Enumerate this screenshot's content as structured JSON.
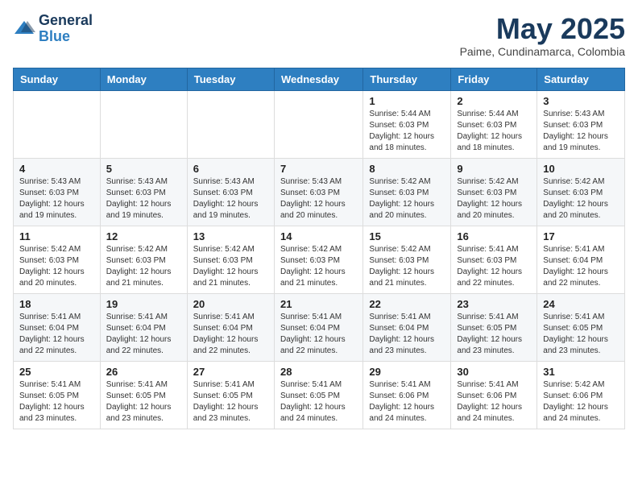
{
  "header": {
    "logo_general": "General",
    "logo_blue": "Blue",
    "title": "May 2025",
    "location": "Paime, Cundinamarca, Colombia"
  },
  "weekdays": [
    "Sunday",
    "Monday",
    "Tuesday",
    "Wednesday",
    "Thursday",
    "Friday",
    "Saturday"
  ],
  "weeks": [
    [
      {
        "day": "",
        "info": ""
      },
      {
        "day": "",
        "info": ""
      },
      {
        "day": "",
        "info": ""
      },
      {
        "day": "",
        "info": ""
      },
      {
        "day": "1",
        "info": "Sunrise: 5:44 AM\nSunset: 6:03 PM\nDaylight: 12 hours\nand 18 minutes."
      },
      {
        "day": "2",
        "info": "Sunrise: 5:44 AM\nSunset: 6:03 PM\nDaylight: 12 hours\nand 18 minutes."
      },
      {
        "day": "3",
        "info": "Sunrise: 5:43 AM\nSunset: 6:03 PM\nDaylight: 12 hours\nand 19 minutes."
      }
    ],
    [
      {
        "day": "4",
        "info": "Sunrise: 5:43 AM\nSunset: 6:03 PM\nDaylight: 12 hours\nand 19 minutes."
      },
      {
        "day": "5",
        "info": "Sunrise: 5:43 AM\nSunset: 6:03 PM\nDaylight: 12 hours\nand 19 minutes."
      },
      {
        "day": "6",
        "info": "Sunrise: 5:43 AM\nSunset: 6:03 PM\nDaylight: 12 hours\nand 19 minutes."
      },
      {
        "day": "7",
        "info": "Sunrise: 5:43 AM\nSunset: 6:03 PM\nDaylight: 12 hours\nand 20 minutes."
      },
      {
        "day": "8",
        "info": "Sunrise: 5:42 AM\nSunset: 6:03 PM\nDaylight: 12 hours\nand 20 minutes."
      },
      {
        "day": "9",
        "info": "Sunrise: 5:42 AM\nSunset: 6:03 PM\nDaylight: 12 hours\nand 20 minutes."
      },
      {
        "day": "10",
        "info": "Sunrise: 5:42 AM\nSunset: 6:03 PM\nDaylight: 12 hours\nand 20 minutes."
      }
    ],
    [
      {
        "day": "11",
        "info": "Sunrise: 5:42 AM\nSunset: 6:03 PM\nDaylight: 12 hours\nand 20 minutes."
      },
      {
        "day": "12",
        "info": "Sunrise: 5:42 AM\nSunset: 6:03 PM\nDaylight: 12 hours\nand 21 minutes."
      },
      {
        "day": "13",
        "info": "Sunrise: 5:42 AM\nSunset: 6:03 PM\nDaylight: 12 hours\nand 21 minutes."
      },
      {
        "day": "14",
        "info": "Sunrise: 5:42 AM\nSunset: 6:03 PM\nDaylight: 12 hours\nand 21 minutes."
      },
      {
        "day": "15",
        "info": "Sunrise: 5:42 AM\nSunset: 6:03 PM\nDaylight: 12 hours\nand 21 minutes."
      },
      {
        "day": "16",
        "info": "Sunrise: 5:41 AM\nSunset: 6:03 PM\nDaylight: 12 hours\nand 22 minutes."
      },
      {
        "day": "17",
        "info": "Sunrise: 5:41 AM\nSunset: 6:04 PM\nDaylight: 12 hours\nand 22 minutes."
      }
    ],
    [
      {
        "day": "18",
        "info": "Sunrise: 5:41 AM\nSunset: 6:04 PM\nDaylight: 12 hours\nand 22 minutes."
      },
      {
        "day": "19",
        "info": "Sunrise: 5:41 AM\nSunset: 6:04 PM\nDaylight: 12 hours\nand 22 minutes."
      },
      {
        "day": "20",
        "info": "Sunrise: 5:41 AM\nSunset: 6:04 PM\nDaylight: 12 hours\nand 22 minutes."
      },
      {
        "day": "21",
        "info": "Sunrise: 5:41 AM\nSunset: 6:04 PM\nDaylight: 12 hours\nand 22 minutes."
      },
      {
        "day": "22",
        "info": "Sunrise: 5:41 AM\nSunset: 6:04 PM\nDaylight: 12 hours\nand 23 minutes."
      },
      {
        "day": "23",
        "info": "Sunrise: 5:41 AM\nSunset: 6:05 PM\nDaylight: 12 hours\nand 23 minutes."
      },
      {
        "day": "24",
        "info": "Sunrise: 5:41 AM\nSunset: 6:05 PM\nDaylight: 12 hours\nand 23 minutes."
      }
    ],
    [
      {
        "day": "25",
        "info": "Sunrise: 5:41 AM\nSunset: 6:05 PM\nDaylight: 12 hours\nand 23 minutes."
      },
      {
        "day": "26",
        "info": "Sunrise: 5:41 AM\nSunset: 6:05 PM\nDaylight: 12 hours\nand 23 minutes."
      },
      {
        "day": "27",
        "info": "Sunrise: 5:41 AM\nSunset: 6:05 PM\nDaylight: 12 hours\nand 23 minutes."
      },
      {
        "day": "28",
        "info": "Sunrise: 5:41 AM\nSunset: 6:05 PM\nDaylight: 12 hours\nand 24 minutes."
      },
      {
        "day": "29",
        "info": "Sunrise: 5:41 AM\nSunset: 6:06 PM\nDaylight: 12 hours\nand 24 minutes."
      },
      {
        "day": "30",
        "info": "Sunrise: 5:41 AM\nSunset: 6:06 PM\nDaylight: 12 hours\nand 24 minutes."
      },
      {
        "day": "31",
        "info": "Sunrise: 5:42 AM\nSunset: 6:06 PM\nDaylight: 12 hours\nand 24 minutes."
      }
    ]
  ]
}
